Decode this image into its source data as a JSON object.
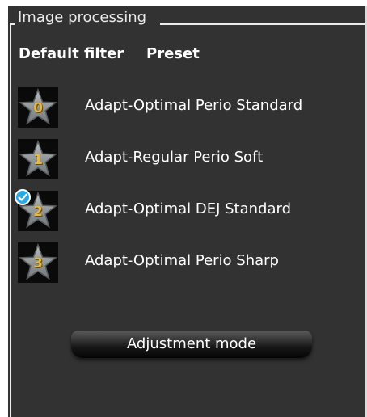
{
  "group": {
    "title": "Image processing"
  },
  "columns": {
    "default_filter": "Default filter",
    "preset": "Preset"
  },
  "presets": [
    {
      "number": "0",
      "label": "Adapt-Optimal Perio Standard",
      "is_default": false,
      "icon": "star-icon"
    },
    {
      "number": "1",
      "label": "Adapt-Regular Perio Soft",
      "is_default": false,
      "icon": "star-icon"
    },
    {
      "number": "2",
      "label": "Adapt-Optimal DEJ Standard",
      "is_default": true,
      "icon": "star-icon"
    },
    {
      "number": "3",
      "label": "Adapt-Optimal Perio Sharp",
      "is_default": false,
      "icon": "star-icon"
    }
  ],
  "adjustment_button": {
    "label": "Adjustment mode"
  },
  "colors": {
    "panel_background": "#323232",
    "text": "#ffffff",
    "star_number": "#e2b84a",
    "default_check": "#29a8e6"
  }
}
